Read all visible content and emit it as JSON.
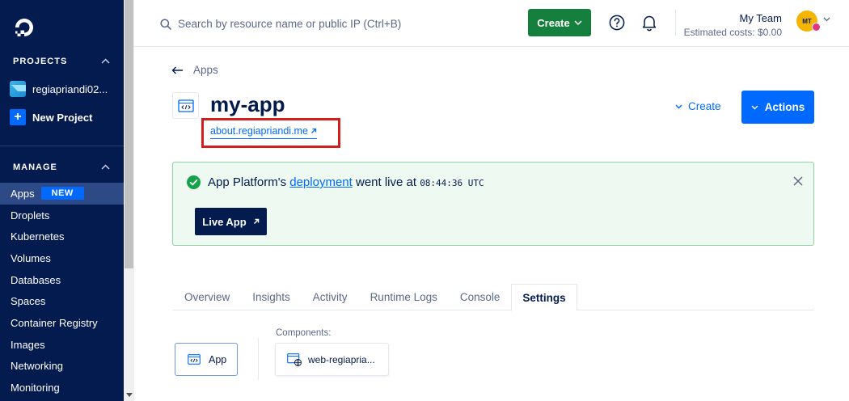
{
  "sidebar": {
    "projects_heading": "PROJECTS",
    "project_name": "regiapriandi02...",
    "new_project_label": "New Project",
    "manage_heading": "MANAGE",
    "nav_items": [
      {
        "label": "Apps",
        "badge": "NEW",
        "active": true
      },
      {
        "label": "Droplets"
      },
      {
        "label": "Kubernetes"
      },
      {
        "label": "Volumes"
      },
      {
        "label": "Databases"
      },
      {
        "label": "Spaces"
      },
      {
        "label": "Container Registry"
      },
      {
        "label": "Images"
      },
      {
        "label": "Networking"
      },
      {
        "label": "Monitoring"
      }
    ]
  },
  "header": {
    "search_placeholder": "Search by resource name or public IP (Ctrl+B)",
    "create_label": "Create",
    "team_name": "My Team",
    "estimated_costs": "Estimated costs: $0.00",
    "avatar_initials": "MT"
  },
  "page": {
    "back_label": "Apps",
    "app_name": "my-app",
    "app_url": "about.regiapriandi.me",
    "create_label": "Create",
    "actions_label": "Actions"
  },
  "banner": {
    "text_before": "App Platform's ",
    "link_text": "deployment",
    "text_after": " went live at ",
    "time": "08:44:36 UTC",
    "live_app_label": "Live App"
  },
  "tabs": [
    {
      "label": "Overview"
    },
    {
      "label": "Insights"
    },
    {
      "label": "Activity"
    },
    {
      "label": "Runtime Logs"
    },
    {
      "label": "Console"
    },
    {
      "label": "Settings",
      "active": true
    }
  ],
  "settings": {
    "app_card_label": "App",
    "components_label": "Components:",
    "component_name": "web-regiapria..."
  },
  "colors": {
    "sidebar_bg": "#031b4e",
    "primary_blue": "#0069ff",
    "create_green": "#15803d",
    "success_bg": "#eef9f1",
    "highlight_red": "#d11f1f"
  },
  "icons": {
    "logo": "digitalocean-logo-icon",
    "search": "search-icon",
    "help": "help-circle-icon",
    "bell": "bell-icon",
    "check": "check-circle-icon",
    "close": "close-icon",
    "external": "external-link-icon",
    "back": "arrow-left-icon"
  }
}
